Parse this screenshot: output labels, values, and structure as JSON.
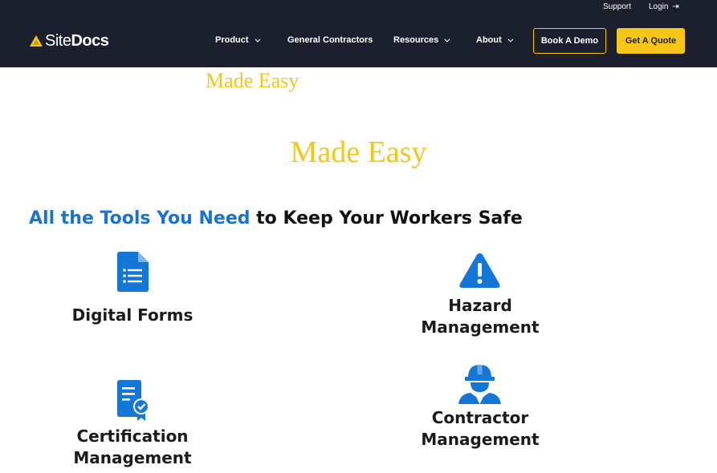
{
  "header": {
    "utility": {
      "support": "Support",
      "login": "Login"
    },
    "logo": {
      "site": "Site",
      "docs": "Docs"
    },
    "nav": [
      {
        "label": "Product",
        "has_dropdown": true
      },
      {
        "label": "General Contractors",
        "has_dropdown": false
      },
      {
        "label": "Resources",
        "has_dropdown": true
      },
      {
        "label": "About",
        "has_dropdown": true
      }
    ],
    "book_demo": "Book A Demo",
    "get_quote": "Get A Quote"
  },
  "hero": {
    "tagline_small": "Made Easy",
    "tagline_large": "Made Easy"
  },
  "section": {
    "title_accent": "All the Tools You Need",
    "title_rest": "to Keep Your Workers Safe"
  },
  "features": [
    {
      "label_line1": "Digital Forms",
      "label_line2": "",
      "icon": "document-list-icon"
    },
    {
      "label_line1": "Hazard",
      "label_line2": "Management",
      "icon": "warning-triangle-icon"
    },
    {
      "label_line1": "Certification",
      "label_line2": "Management",
      "icon": "certificate-icon"
    },
    {
      "label_line1": "Contractor",
      "label_line2": "Management",
      "icon": "hard-hat-worker-icon"
    }
  ],
  "colors": {
    "header_bg": "#1c1f2e",
    "brand_yellow": "#f5c518",
    "accent_blue": "#1a73d1",
    "icon_blue": "#1477d6"
  }
}
